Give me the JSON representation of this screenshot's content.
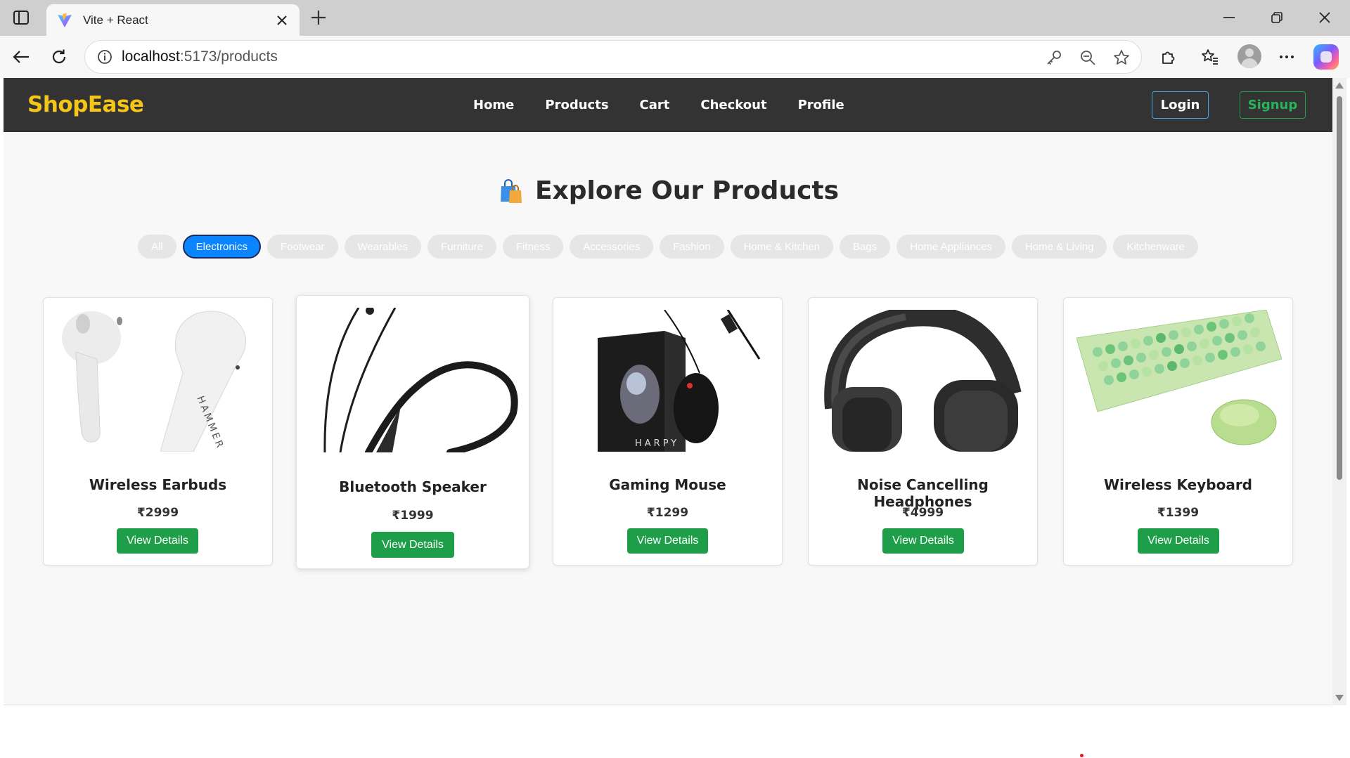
{
  "browser": {
    "tab_title": "Vite + React",
    "url_host": "localhost",
    "url_rest": ":5173/products"
  },
  "site": {
    "brand": "ShopEase",
    "nav": [
      "Home",
      "Products",
      "Cart",
      "Checkout",
      "Profile"
    ],
    "login_label": "Login",
    "signup_label": "Signup"
  },
  "page": {
    "heading": "Explore Our Products",
    "filters": [
      "All",
      "Electronics",
      "Footwear",
      "Wearables",
      "Furniture",
      "Fitness",
      "Accessories",
      "Fashion",
      "Home & Kitchen",
      "Bags",
      "Home Appliances",
      "Home & Living",
      "Kitchenware"
    ],
    "active_filter": "Electronics"
  },
  "products": [
    {
      "name": "Wireless Earbuds",
      "price": "₹2999",
      "button": "View Details"
    },
    {
      "name": "Bluetooth Speaker",
      "price": "₹1999",
      "button": "View Details"
    },
    {
      "name": "Gaming Mouse",
      "price": "₹1299",
      "button": "View Details"
    },
    {
      "name": "Noise Cancelling Headphones",
      "price": "₹4999",
      "button": "View Details"
    },
    {
      "name": "Wireless Keyboard",
      "price": "₹1399",
      "button": "View Details"
    }
  ],
  "product_image_texts": [
    "HAMMER",
    "HARPY"
  ],
  "colors": {
    "navbar": "#333333",
    "brand": "#f5c518",
    "active_chip": "#0a84ff",
    "view_button": "#1f9e4a"
  }
}
